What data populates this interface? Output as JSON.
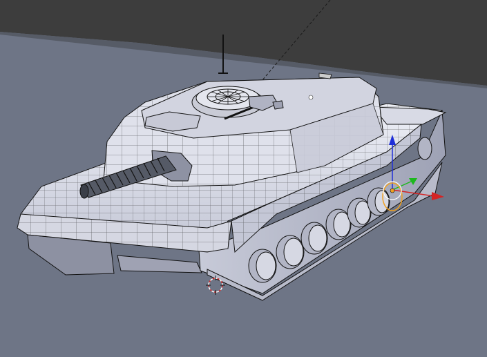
{
  "app": {
    "name": "3D viewport"
  },
  "viewport": {
    "background_floor": "#6e7586",
    "background_top": "#3d3d3d",
    "mesh_fill_light": "#e6e7ef",
    "mesh_fill_mid": "#c9cbd8",
    "mesh_fill_shadow": "#8a8ea0",
    "wire_color": "#111111"
  },
  "gizmo": {
    "x_color": "#d42424",
    "y_color": "#1db81d",
    "z_color": "#1f2fd8",
    "pivot_color": "#f0a020"
  },
  "cursor_3d": {
    "outer_color": "#d22a2a",
    "inner_color": "#ffffff"
  },
  "icons": {
    "cursor": "3d-cursor-icon",
    "transform": "transform-gizmo-icon"
  }
}
